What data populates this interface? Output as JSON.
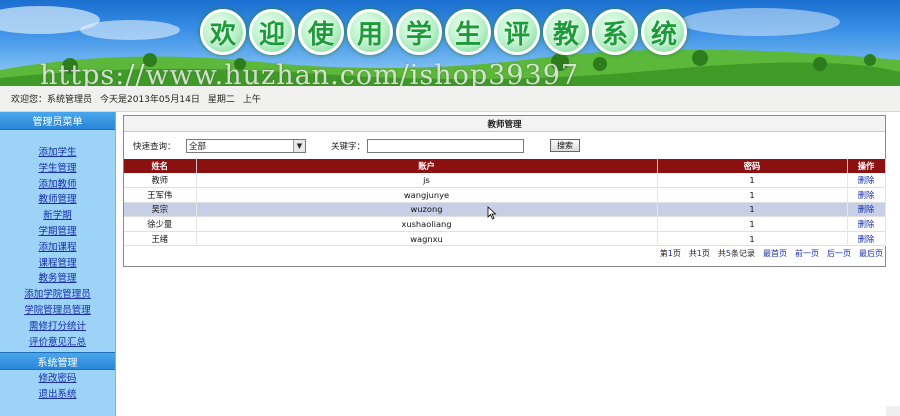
{
  "banner": {
    "title_chars": [
      "欢",
      "迎",
      "使",
      "用",
      "学",
      "生",
      "评",
      "教",
      "系",
      "统"
    ],
    "watermark": "https://www.huzhan.com/ishop39397"
  },
  "status": {
    "welcome": "欢迎您：系统管理员",
    "date": "今天是2013年05月14日",
    "weekday": "星期二",
    "period": "上午"
  },
  "sidebar": {
    "header": "管理员菜单",
    "items": [
      {
        "label": "添加学生"
      },
      {
        "label": "学生管理"
      },
      {
        "label": "添加教师"
      },
      {
        "label": "教师管理"
      },
      {
        "label": "新学期"
      },
      {
        "label": "学期管理"
      },
      {
        "label": "添加课程"
      },
      {
        "label": "课程管理"
      },
      {
        "label": "教务管理"
      },
      {
        "label": "添加学院管理员"
      },
      {
        "label": "学院管理员管理"
      },
      {
        "label": "需修打分统计"
      },
      {
        "label": "评价意见汇总"
      }
    ],
    "system_header": "系统管理",
    "system_items": [
      {
        "label": "修改密码"
      },
      {
        "label": "退出系统"
      }
    ]
  },
  "panel": {
    "title": "教师管理",
    "quick_label": "快速查询：",
    "quick_value": "全部",
    "keyword_label": "关键字：",
    "keyword_value": "",
    "search_button": "搜索"
  },
  "table": {
    "columns": [
      "姓名",
      "账户",
      "密码",
      "操作"
    ],
    "rows": [
      {
        "name": "教师",
        "account": "js",
        "password": "1",
        "op": "删除"
      },
      {
        "name": "王军伟",
        "account": "wangjunye",
        "password": "1",
        "op": "删除"
      },
      {
        "name": "吴宗",
        "account": "wuzong",
        "password": "1",
        "op": "删除"
      },
      {
        "name": "徐少量",
        "account": "xushaoliang",
        "password": "1",
        "op": "删除"
      },
      {
        "name": "王绪",
        "account": "wagnxu",
        "password": "1",
        "op": "删除"
      }
    ],
    "highlight_row": 2
  },
  "pager": {
    "page_prefix": "第",
    "page_num": "1",
    "page_suffix": "页",
    "total_prefix": "共",
    "total_pages": "1",
    "total_suffix": "页",
    "records_prefix": "共",
    "records": "5",
    "records_suffix": "条记录",
    "first": "最首页",
    "prev": "前一页",
    "next": "后一页",
    "last": "最后页"
  },
  "colors": {
    "header_bar": "#8b1010",
    "sidebar_bg": "#9dd3f7",
    "link": "#1a2fa8",
    "highlight": "#c7cfe6"
  }
}
